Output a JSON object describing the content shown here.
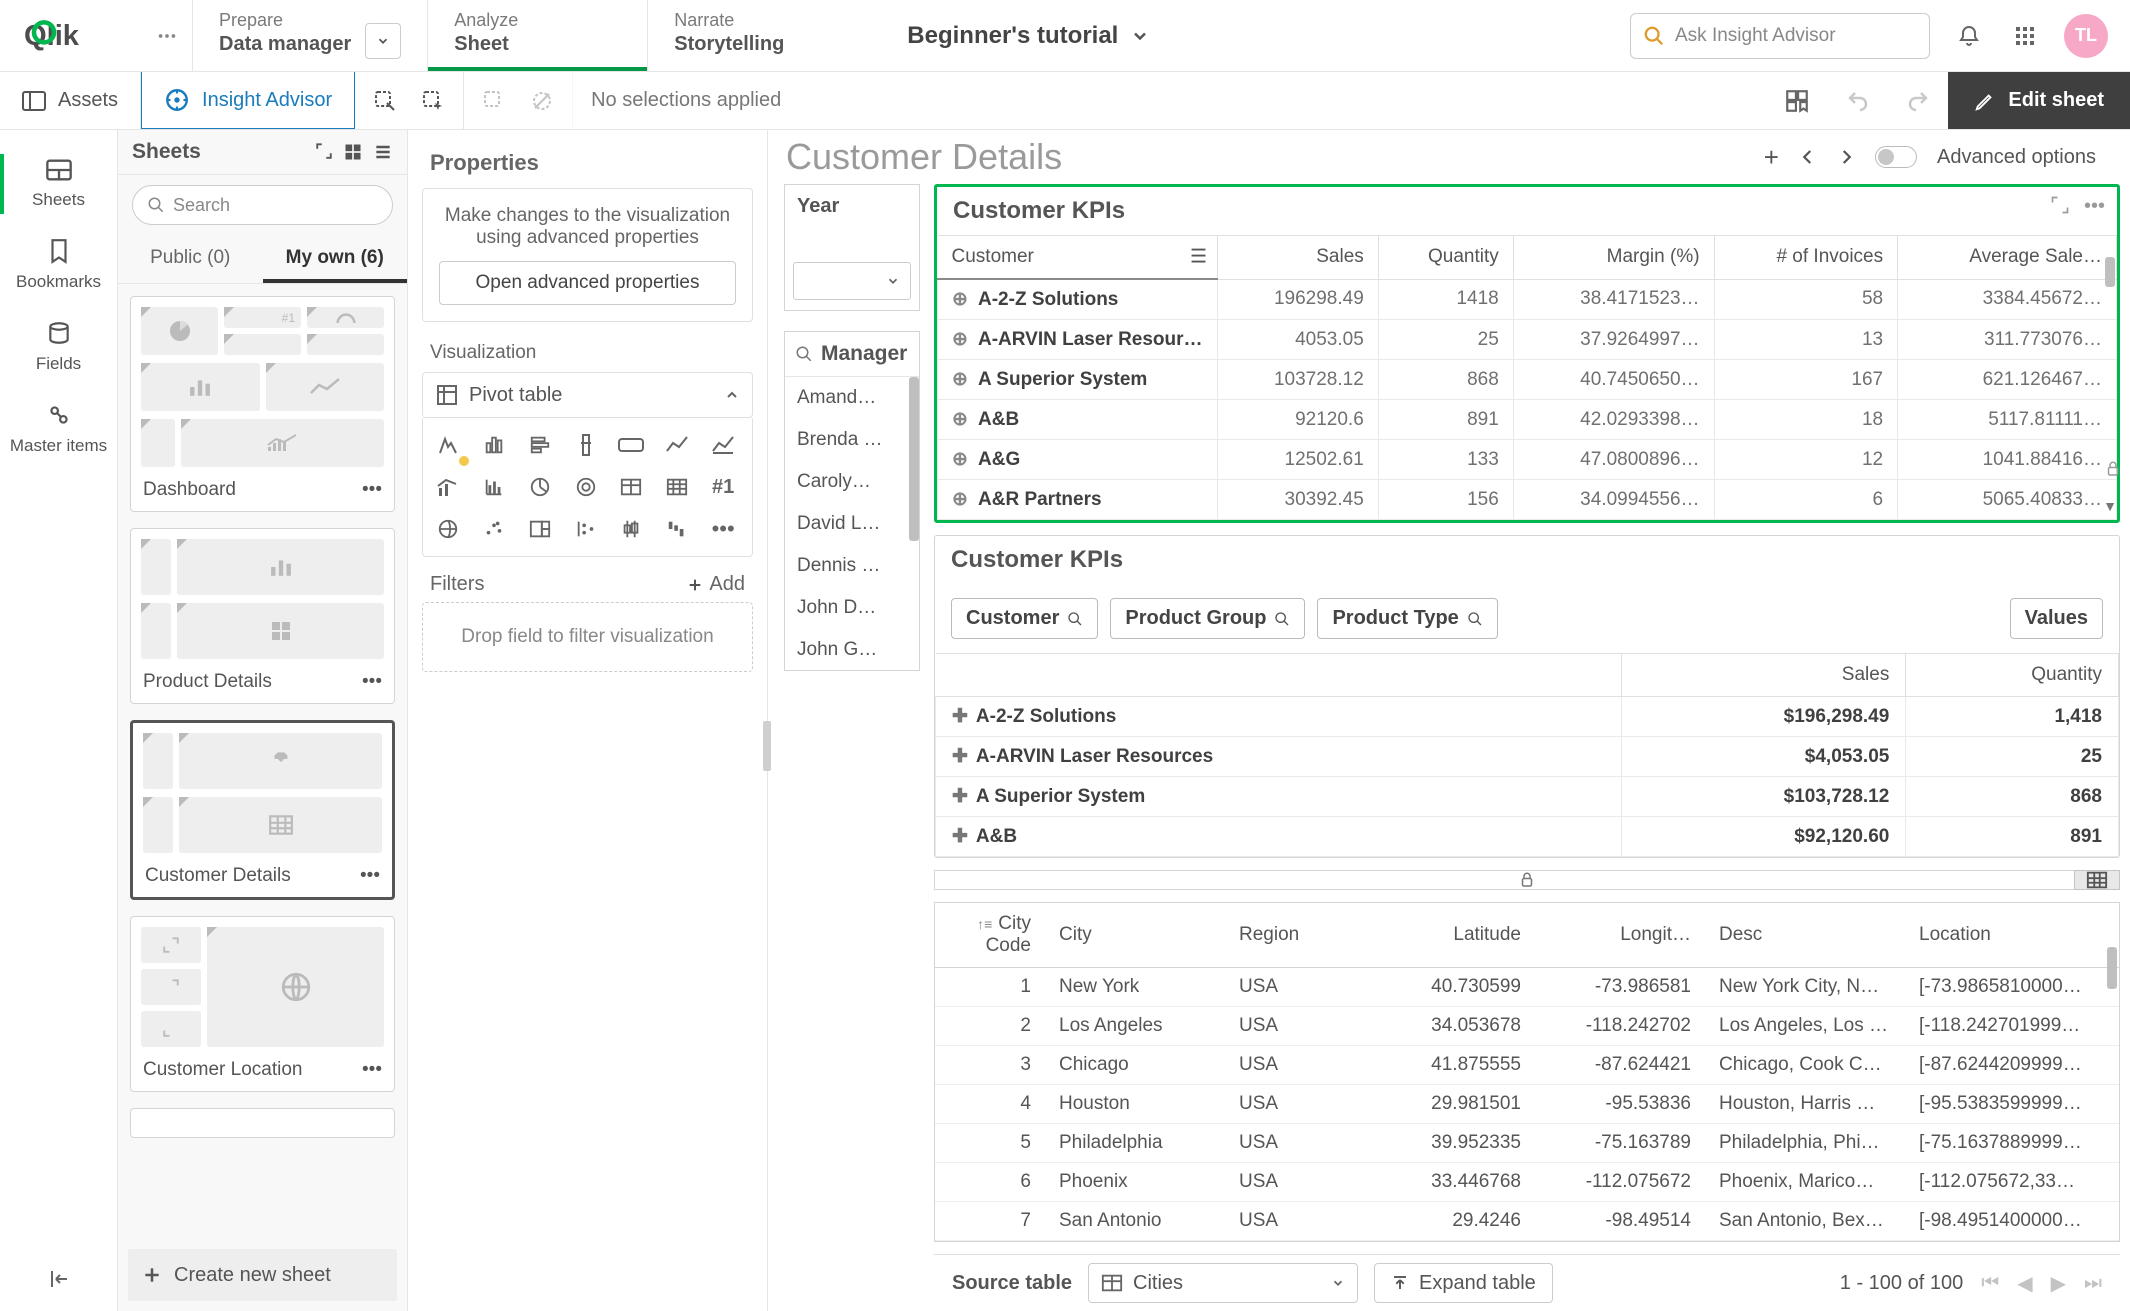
{
  "nav": {
    "prepare_top": "Prepare",
    "prepare_bot": "Data manager",
    "analyze_top": "Analyze",
    "analyze_bot": "Sheet",
    "narrate_top": "Narrate",
    "narrate_bot": "Storytelling",
    "app_title": "Beginner's tutorial",
    "search_placeholder": "Ask Insight Advisor",
    "avatar": "TL"
  },
  "selbar": {
    "assets": "Assets",
    "insight": "Insight Advisor",
    "no_sel": "No selections applied",
    "edit": "Edit sheet"
  },
  "rail": {
    "sheets": "Sheets",
    "bookmarks": "Bookmarks",
    "fields": "Fields",
    "master": "Master items"
  },
  "sheets": {
    "title": "Sheets",
    "search_placeholder": "Search",
    "tab_public": "Public (0)",
    "tab_myown": "My own (6)",
    "card_dashboard": "Dashboard",
    "card_product": "Product Details",
    "card_customer_details": "Customer Details",
    "card_customer_location": "Customer Location",
    "create": "Create new sheet"
  },
  "props": {
    "title": "Properties",
    "hint": "Make changes to the visualization using advanced properties",
    "open_btn": "Open advanced properties",
    "viz_title": "Visualization",
    "pivot": "Pivot table",
    "filters": "Filters",
    "add": "Add",
    "drop": "Drop field to filter visualization"
  },
  "canvas": {
    "title": "Customer Details",
    "advanced": "Advanced options",
    "year": "Year",
    "manager": "Manager",
    "managers": [
      "Amand…",
      "Brenda …",
      "Caroly…",
      "David L…",
      "Dennis …",
      "John D…",
      "John G…"
    ]
  },
  "kpi": {
    "title": "Customer KPIs",
    "cols": [
      "Customer",
      "Sales",
      "Quantity",
      "Margin (%)",
      "# of Invoices",
      "Average Sale…"
    ],
    "rows": [
      {
        "c": "A-2-Z Solutions",
        "s": "196298.49",
        "q": "1418",
        "m": "38.4171523…",
        "i": "58",
        "a": "3384.45672…"
      },
      {
        "c": "A-ARVIN Laser Resources",
        "s": "4053.05",
        "q": "25",
        "m": "37.9264997…",
        "i": "13",
        "a": "311.773076…"
      },
      {
        "c": "A Superior System",
        "s": "103728.12",
        "q": "868",
        "m": "40.7450650…",
        "i": "167",
        "a": "621.126467…"
      },
      {
        "c": "A&B",
        "s": "92120.6",
        "q": "891",
        "m": "42.0293398…",
        "i": "18",
        "a": "5117.81111…"
      },
      {
        "c": "A&G",
        "s": "12502.61",
        "q": "133",
        "m": "47.0800896…",
        "i": "12",
        "a": "1041.88416…"
      },
      {
        "c": "A&R Partners",
        "s": "30392.45",
        "q": "156",
        "m": "34.0994556…",
        "i": "6",
        "a": "5065.40833…"
      }
    ]
  },
  "pivot": {
    "title": "Customer KPIs",
    "f_customer": "Customer",
    "f_group": "Product Group",
    "f_type": "Product Type",
    "f_values": "Values",
    "col_sales": "Sales",
    "col_qty": "Quantity",
    "rows": [
      {
        "c": "A-2-Z Solutions",
        "s": "$196,298.49",
        "q": "1,418"
      },
      {
        "c": "A-ARVIN Laser Resources",
        "s": "$4,053.05",
        "q": "25"
      },
      {
        "c": "A Superior System",
        "s": "$103,728.12",
        "q": "868"
      },
      {
        "c": "A&B",
        "s": "$92,120.60",
        "q": "891"
      }
    ]
  },
  "city": {
    "cols": [
      "City Code",
      "City",
      "Region",
      "Latitude",
      "Longit…",
      "Desc",
      "Location"
    ],
    "rows": [
      {
        "n": "1",
        "city": "New York",
        "r": "USA",
        "lat": "40.730599",
        "lon": "-73.986581",
        "d": "New York City, N…",
        "loc": "[-73.9865810000…"
      },
      {
        "n": "2",
        "city": "Los Angeles",
        "r": "USA",
        "lat": "34.053678",
        "lon": "-118.242702",
        "d": "Los Angeles, Los …",
        "loc": "[-118.242701999…"
      },
      {
        "n": "3",
        "city": "Chicago",
        "r": "USA",
        "lat": "41.875555",
        "lon": "-87.624421",
        "d": "Chicago, Cook C…",
        "loc": "[-87.6244209999…"
      },
      {
        "n": "4",
        "city": "Houston",
        "r": "USA",
        "lat": "29.981501",
        "lon": "-95.53836",
        "d": "Houston, Harris …",
        "loc": "[-95.5383599999…"
      },
      {
        "n": "5",
        "city": "Philadelphia",
        "r": "USA",
        "lat": "39.952335",
        "lon": "-75.163789",
        "d": "Philadelphia, Phi…",
        "loc": "[-75.1637889999…"
      },
      {
        "n": "6",
        "city": "Phoenix",
        "r": "USA",
        "lat": "33.446768",
        "lon": "-112.075672",
        "d": "Phoenix, Marico…",
        "loc": "[-112.075672,33…"
      },
      {
        "n": "7",
        "city": "San Antonio",
        "r": "USA",
        "lat": "29.4246",
        "lon": "-98.49514",
        "d": "San Antonio, Bex…",
        "loc": "[-98.4951400000…"
      }
    ]
  },
  "source": {
    "label": "Source table",
    "value": "Cities",
    "expand": "Expand table",
    "pager": "1 - 100 of 100"
  }
}
